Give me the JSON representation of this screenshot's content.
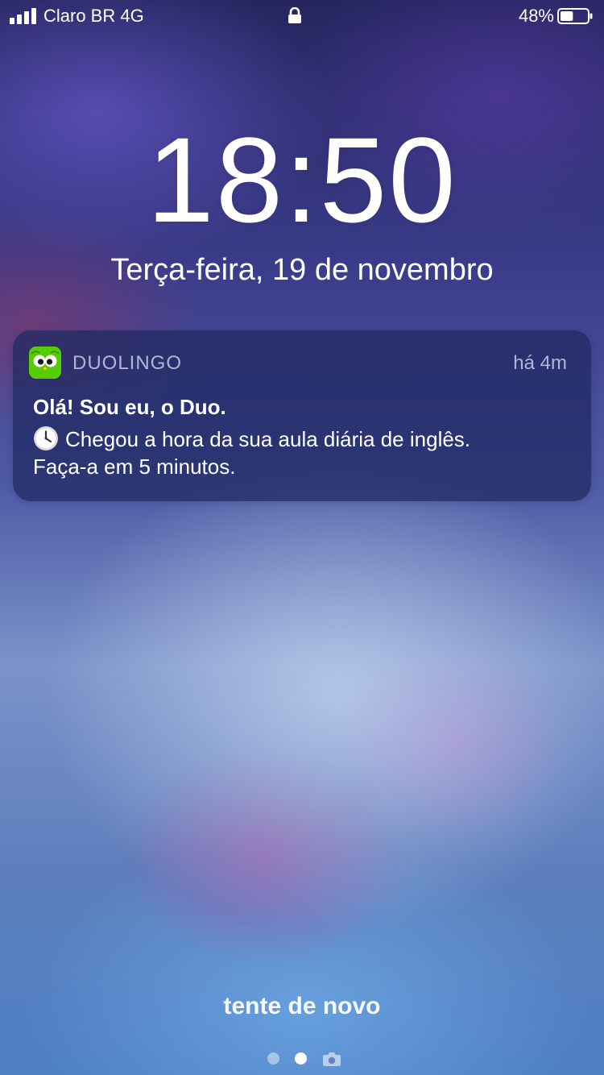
{
  "status_bar": {
    "carrier": "Claro BR",
    "network": "4G",
    "battery_percent": "48%",
    "battery_level": 0.48,
    "signal_bars": 4,
    "icons": [
      "signal-icon",
      "lock-icon",
      "battery-icon"
    ]
  },
  "lock_screen": {
    "time": "18:50",
    "date": "Terça-feira, 19 de novembro"
  },
  "notification": {
    "app_name": "DUOLINGO",
    "time_ago": "há 4m",
    "title": "Olá! Sou eu, o Duo.",
    "body_line1": "Chegou a hora da sua aula diária de inglês.",
    "body_line2": "Faça-a em 5 minutos.",
    "app_icon": "duolingo-owl-icon",
    "emoji": "clock-icon",
    "colors": {
      "app_icon_bg": "#58cc02"
    }
  },
  "bottom": {
    "hint": "tente de novo",
    "page_count": 2,
    "active_page": 2,
    "camera_icon": "camera-icon"
  }
}
